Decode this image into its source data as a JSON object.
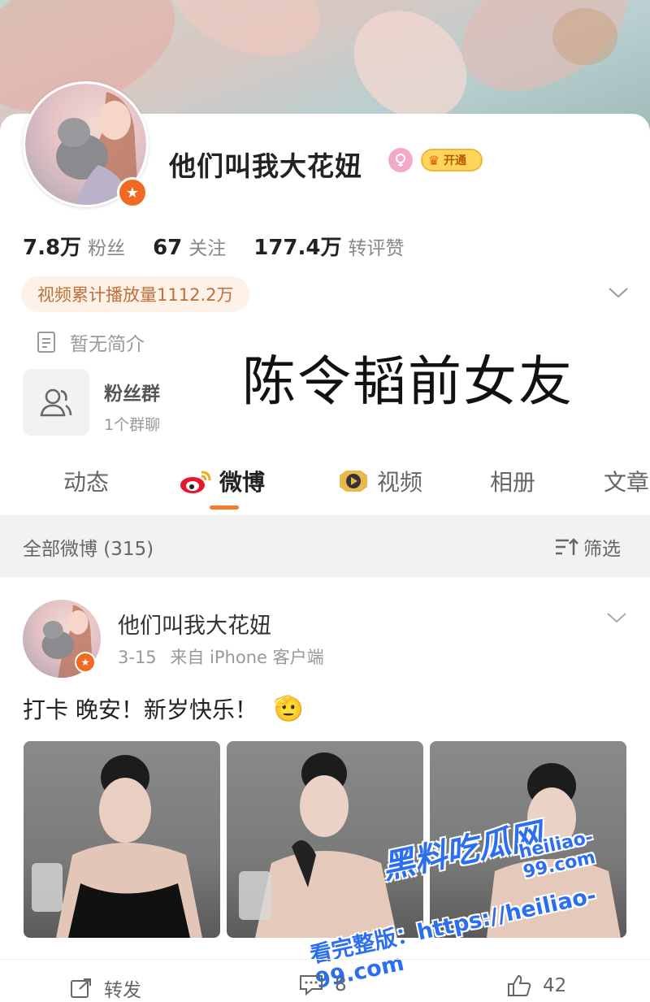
{
  "profile": {
    "nickname": "他们叫我大花妞",
    "vip_label": "开通",
    "stats": [
      {
        "num": "7.8万",
        "label": "粉丝"
      },
      {
        "num": "67",
        "label": "关注"
      },
      {
        "num": "177.4万",
        "label": "转评赞"
      }
    ],
    "plays": "视频累计播放量1112.2万",
    "intro": "暂无简介",
    "fan_group": {
      "title": "粉丝群",
      "sub": "1个群聊"
    }
  },
  "overlay_caption": "陈令韬前女友",
  "tabs": [
    {
      "label": "动态",
      "icon": null
    },
    {
      "label": "微博",
      "icon": "weibo-icon"
    },
    {
      "label": "视频",
      "icon": "video-badge-icon"
    },
    {
      "label": "相册",
      "icon": null
    },
    {
      "label": "文章",
      "icon": null
    }
  ],
  "filter_bar": {
    "all_label": "全部微博 (315)",
    "filter_label": "筛选"
  },
  "post": {
    "author": "他们叫我大花妞",
    "date": "3-15",
    "source": "来自 iPhone 客户端",
    "text": "打卡 晚安！新岁快乐！",
    "emoji": "🫡",
    "actions": {
      "repost": "转发",
      "comments": "8",
      "likes": "42"
    }
  },
  "watermark": {
    "brand": "黑料吃瓜网",
    "domain": "heiliao-99.com",
    "line": "看完整版：https://heiliao-99.com"
  },
  "colors": {
    "accent": "#f77b2a",
    "vip": "#ffd45a",
    "verified": "#f26a21",
    "plays_text": "#c0703a"
  }
}
